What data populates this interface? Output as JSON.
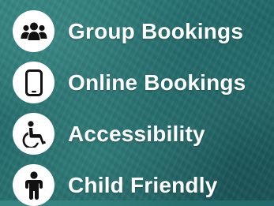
{
  "features": [
    {
      "label": "Group Bookings",
      "icon": "users-group-icon"
    },
    {
      "label": "Online Bookings",
      "icon": "smartphone-icon"
    },
    {
      "label": "Accessibility",
      "icon": "wheelchair-icon"
    },
    {
      "label": "Child Friendly",
      "icon": "child-icon"
    }
  ],
  "colors": {
    "icon_background": "#ffffff",
    "icon_glyph": "#111111",
    "label_text": "#ffffff",
    "background": "#236b6b"
  }
}
